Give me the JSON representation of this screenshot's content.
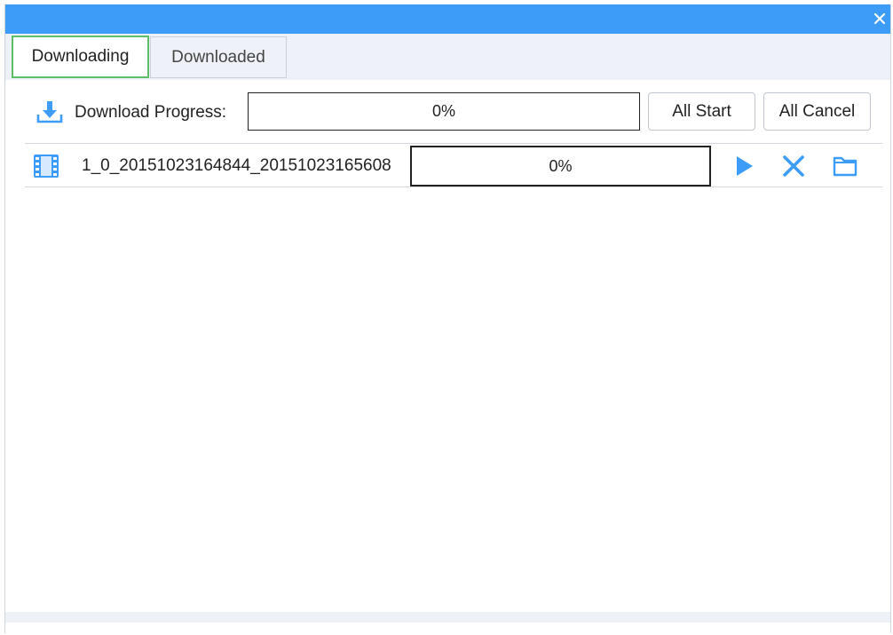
{
  "window": {
    "close_icon": "close-icon",
    "colors": {
      "titlebar": "#3c9cf8",
      "accent": "#3c9cf8",
      "active_tab_border": "#5cbf67"
    }
  },
  "tabs": [
    {
      "label": "Downloading",
      "active": true
    },
    {
      "label": "Downloaded",
      "active": false
    }
  ],
  "progress": {
    "icon": "download-icon",
    "label": "Download Progress:",
    "overall_value": "0%",
    "all_start_label": "All Start",
    "all_cancel_label": "All Cancel"
  },
  "files": [
    {
      "icon": "video-file-icon",
      "name": "1_0_20151023164844_20151023165608",
      "progress": "0%",
      "actions": [
        "play-icon",
        "cancel-icon",
        "folder-icon"
      ]
    }
  ]
}
